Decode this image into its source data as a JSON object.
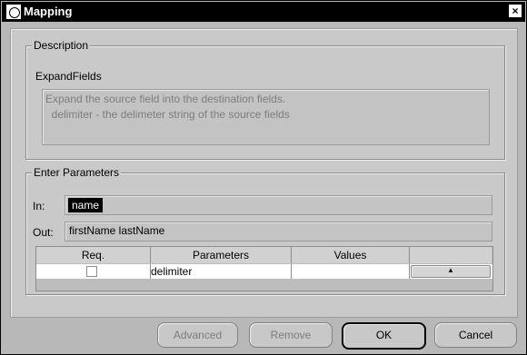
{
  "window": {
    "title": "Mapping",
    "close_glyph": "×",
    "icon": "app-icon"
  },
  "description": {
    "legend": "Description",
    "name": "ExpandFields",
    "text_line1": "Expand the source field into the destination fields.",
    "text_line2": "  delimiter - the delimeter string of the source fields"
  },
  "parameters": {
    "legend": "Enter Parameters",
    "in_label": "In:",
    "in_value": "name",
    "out_label": "Out:",
    "out_value": "firstName  lastName",
    "table": {
      "headers": [
        "Req.",
        "Parameters",
        "Values",
        ""
      ],
      "rows": [
        {
          "req": false,
          "parameter": "delimiter",
          "value": "",
          "button": "▴"
        }
      ]
    }
  },
  "buttons": {
    "advanced": "Advanced",
    "remove": "Remove",
    "ok": "OK",
    "cancel": "Cancel"
  }
}
